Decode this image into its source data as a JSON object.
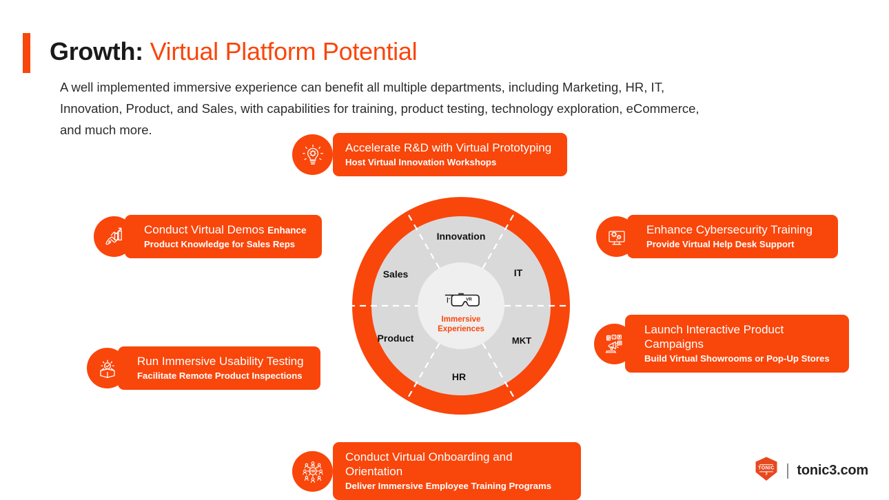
{
  "header": {
    "title_main": "Growth:",
    "title_accent": "Virtual Platform Potential",
    "intro": "A well implemented immersive experience can benefit all multiple departments, including Marketing, HR, IT, Innovation, Product, and Sales, with capabilities for training, product testing, technology exploration, eCommerce, and much more."
  },
  "colors": {
    "accent": "#f9460b",
    "ring": "#f9460b",
    "band": "#d9d9d9",
    "core": "#efefef",
    "text_dark": "#1a1a1a"
  },
  "callouts": [
    {
      "id": "rd",
      "icon": "lightbulb-gear-icon",
      "title": "Accelerate R&D with Virtual Prototyping",
      "title_tail": "",
      "subtitle": "Host Virtual Innovation Workshops"
    },
    {
      "id": "demos",
      "icon": "growth-chart-hand-icon",
      "title": "Conduct Virtual Demos ",
      "title_tail": "Enhance",
      "subtitle": "Product Knowledge for Sales Reps"
    },
    {
      "id": "usability",
      "icon": "box-check-icon",
      "title": "Run Immersive Usability Testing",
      "title_tail": "",
      "subtitle": "Facilitate Remote Product Inspections"
    },
    {
      "id": "cyber",
      "icon": "monitor-gears-icon",
      "title": "Enhance Cybersecurity Training",
      "title_tail": "",
      "subtitle": "Provide Virtual Help Desk Support"
    },
    {
      "id": "campaigns",
      "icon": "megaphone-social-icon",
      "title": "Launch Interactive Product Campaigns",
      "title_tail": "",
      "subtitle": "Build Virtual Showrooms or Pop-Up Stores"
    },
    {
      "id": "onboarding",
      "icon": "hr-network-icon",
      "title": "Conduct Virtual Onboarding and Orientation",
      "title_tail": "",
      "subtitle": "Deliver Immersive Employee Training Programs"
    }
  ],
  "wheel": {
    "center_icon": "vr-headset-icon",
    "center_icon_text": "VR",
    "center_label_line1": "Immersive",
    "center_label_line2": "Experiences",
    "segments": [
      {
        "label": "Innovation",
        "font_size": 14
      },
      {
        "label": "IT",
        "font_size": 14
      },
      {
        "label": "MKT",
        "font_size": 13
      },
      {
        "label": "HR",
        "font_size": 14
      },
      {
        "label": "Product",
        "font_size": 14
      },
      {
        "label": "Sales",
        "font_size": 14
      }
    ]
  },
  "footer": {
    "logo_mark_text": "TONIC",
    "logo_mark_sub": "3",
    "brand": "tonic3.com"
  }
}
